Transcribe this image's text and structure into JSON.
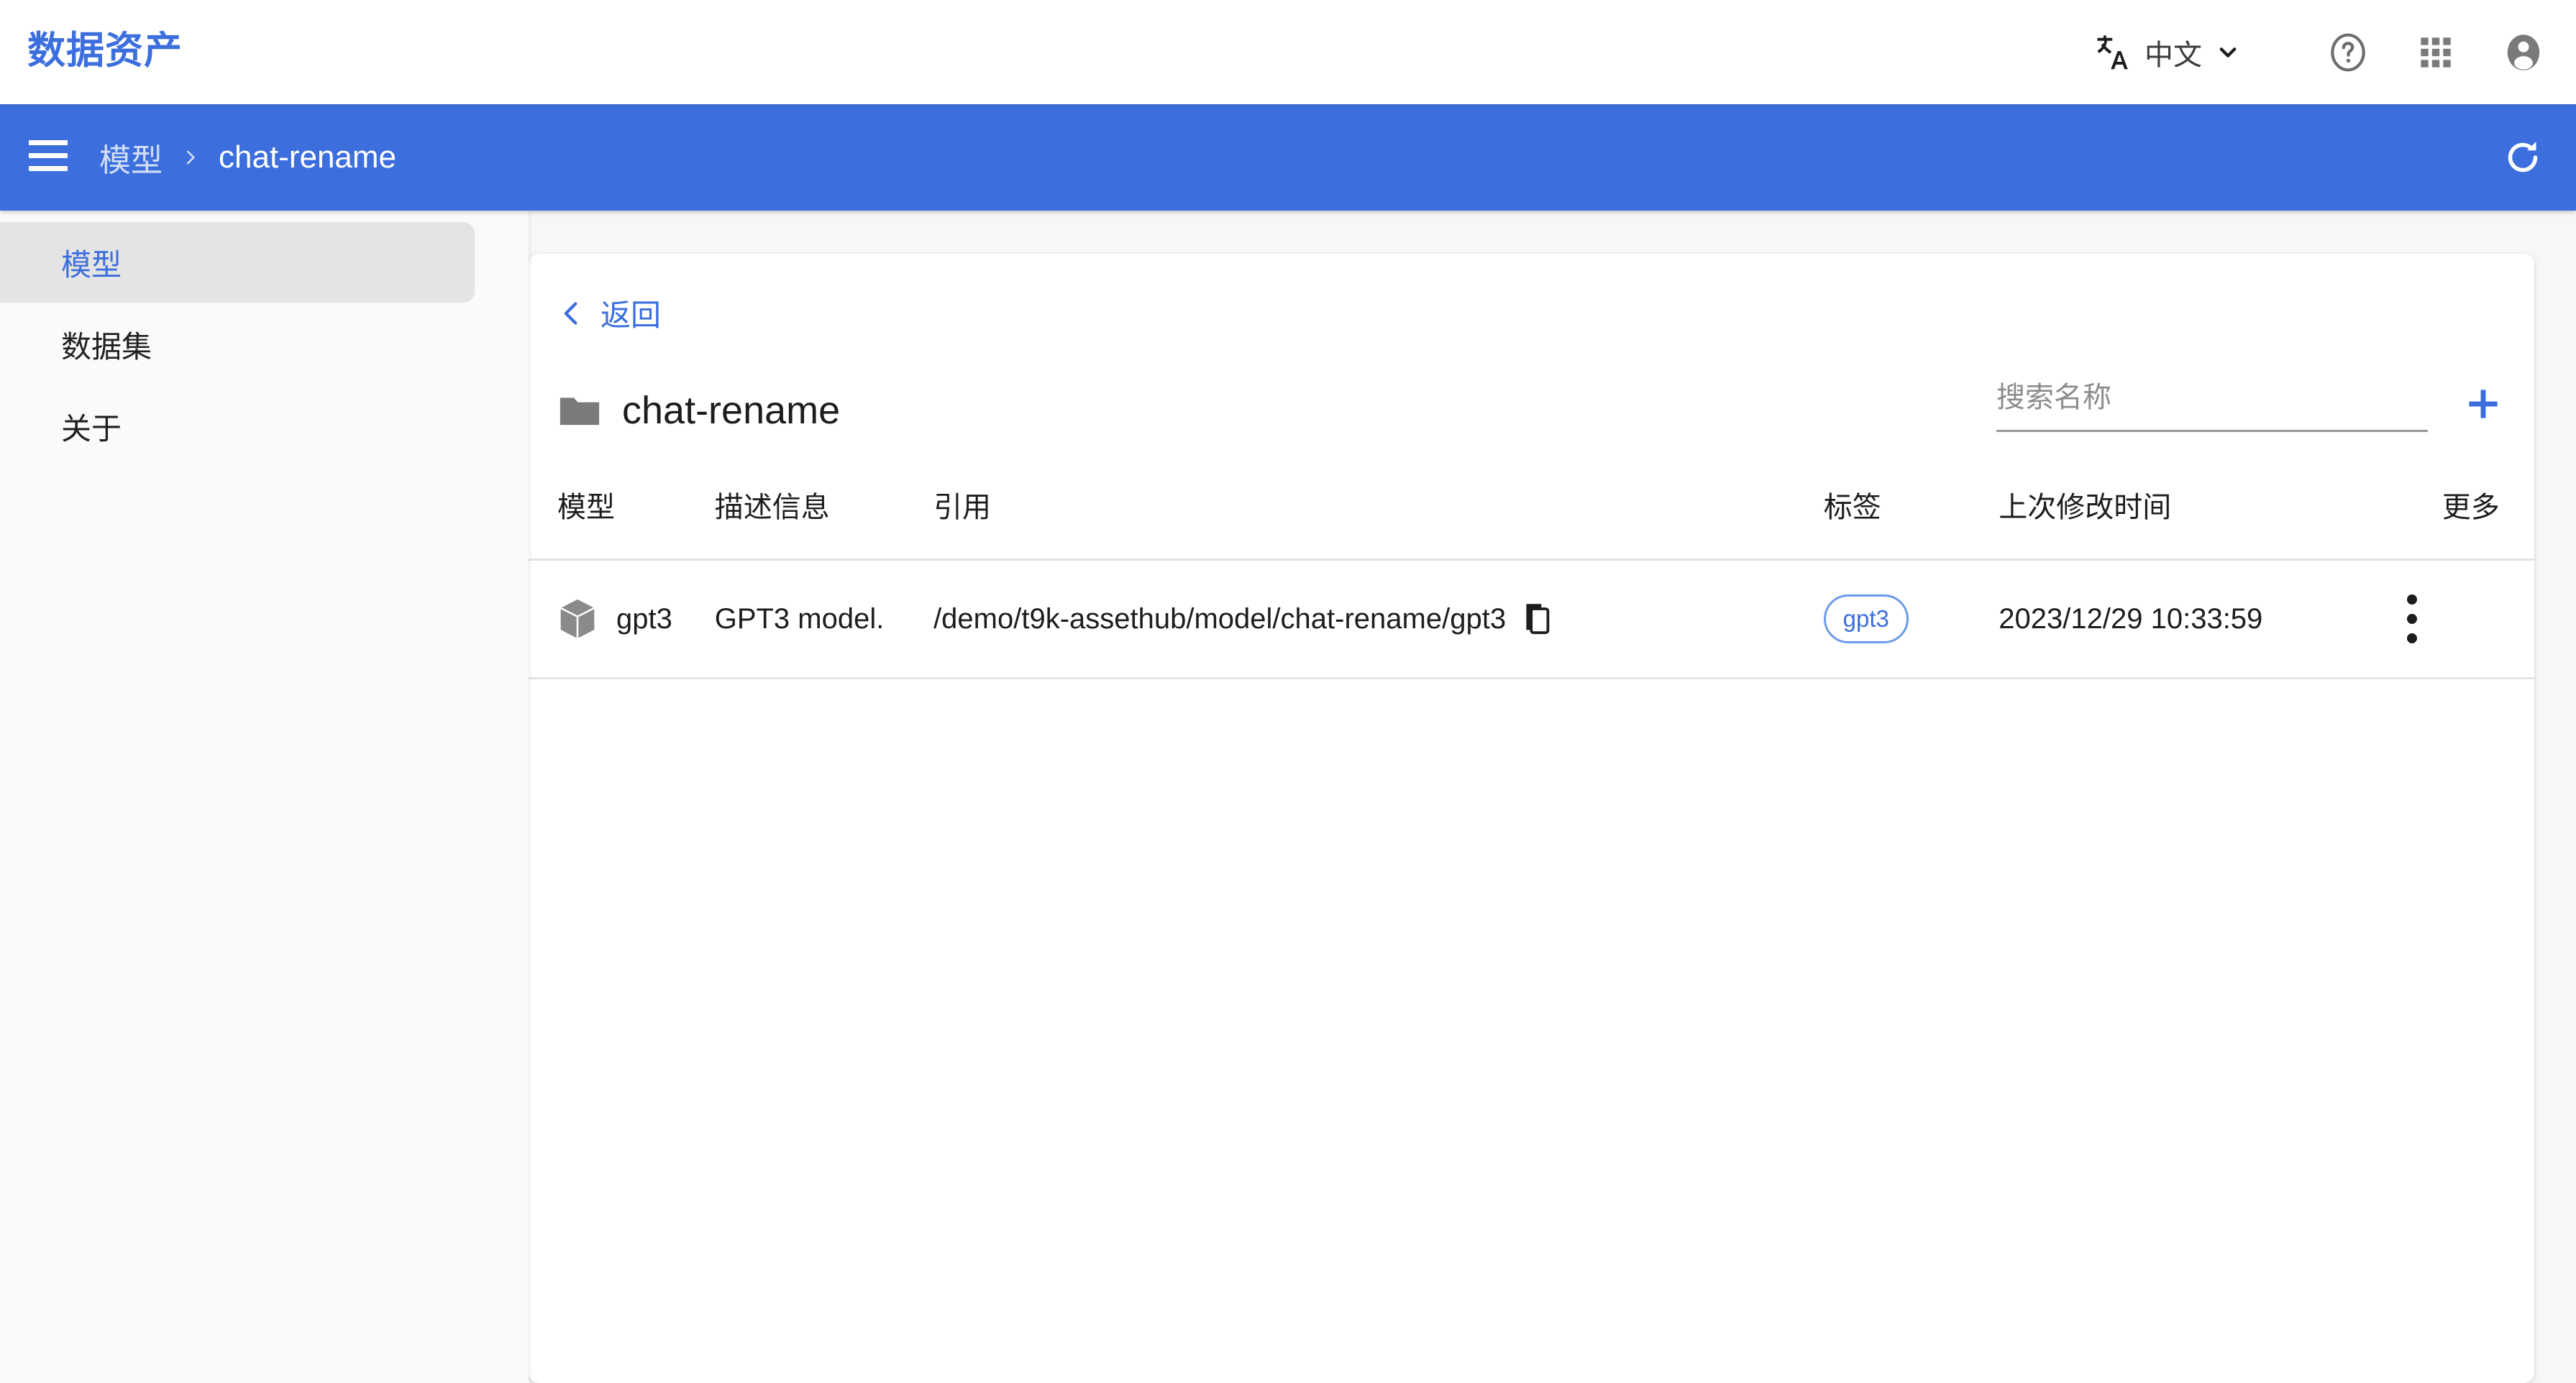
{
  "app": {
    "title": "数据资产",
    "accent_color": "#3c6fdd",
    "bar_color": "#3c6fdd"
  },
  "topbar": {
    "language_label": "中文",
    "translate_icon": "translate-icon",
    "chevron_icon": "chevron-down-icon",
    "help_icon": "help-circle-icon",
    "apps_icon": "apps-grid-icon",
    "account_icon": "account-circle-icon"
  },
  "bluebar": {
    "menu_icon": "hamburger-menu-icon",
    "breadcrumb": {
      "root": "模型",
      "separator": "chevron-right-icon",
      "current": "chat-rename"
    },
    "refresh_icon": "refresh-icon"
  },
  "sidebar": {
    "items": [
      {
        "label": "模型",
        "active": true
      },
      {
        "label": "数据集",
        "active": false
      },
      {
        "label": "关于",
        "active": false
      }
    ]
  },
  "main": {
    "back": {
      "label": "返回",
      "icon": "chevron-left-icon"
    },
    "folder": {
      "icon": "folder-icon",
      "name": "chat-rename"
    },
    "search": {
      "value": "",
      "placeholder": "搜索名称"
    },
    "add_button": {
      "icon": "plus-icon",
      "label": "+"
    },
    "table": {
      "headers": [
        "模型",
        "描述信息",
        "引用",
        "标签",
        "上次修改时间",
        "更多"
      ],
      "rows": [
        {
          "icon": "cube-icon",
          "model": "gpt3",
          "description": "GPT3 model.",
          "reference": "/demo/t9k-assethub/model/chat-rename/gpt3",
          "copy_icon": "copy-icon",
          "tag": "gpt3",
          "last_modified": "2023/12/29 10:33:59",
          "more_icon": "more-vertical-icon"
        }
      ]
    }
  }
}
